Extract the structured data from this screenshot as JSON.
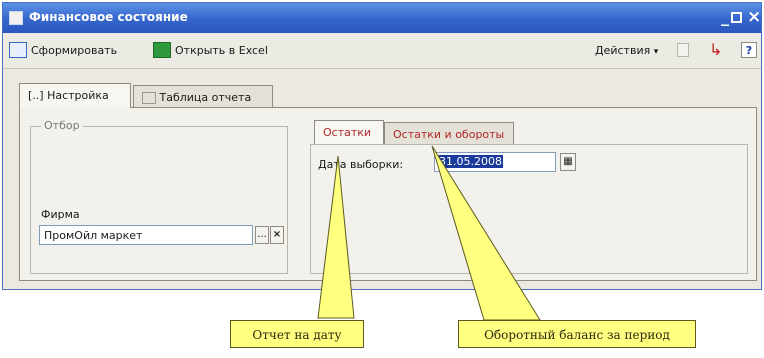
{
  "window": {
    "title": "Финансовое состояние",
    "controls": {
      "minimize": "_",
      "close": "×"
    }
  },
  "toolbar": {
    "generate_label": "Сформировать",
    "open_excel_label": "Открыть в Excel",
    "actions_label": "Действия",
    "help_label": "?"
  },
  "tabs": [
    {
      "label": "Настройка",
      "icon": "[..]",
      "active": true
    },
    {
      "label": "Таблица отчета",
      "active": false
    }
  ],
  "filter": {
    "group_title": "Отбор",
    "firm_label": "Фирма",
    "firm_value": "ПромОйл маркет",
    "select_btn": "...",
    "clear_btn": "×"
  },
  "inner_tabs": [
    {
      "label": "Остатки",
      "active": true
    },
    {
      "label": "Остатки и обороты",
      "active": false
    }
  ],
  "date": {
    "label": "Дата выборки:",
    "value": "31.05.2008"
  },
  "callouts": {
    "left": "Отчет на дату",
    "right": "Оборотный баланс за период"
  },
  "colors": {
    "titlebar": "#3565cc",
    "callout": "#ffff80",
    "tab_red": "#b02828",
    "selection": "#1a3a9c"
  }
}
